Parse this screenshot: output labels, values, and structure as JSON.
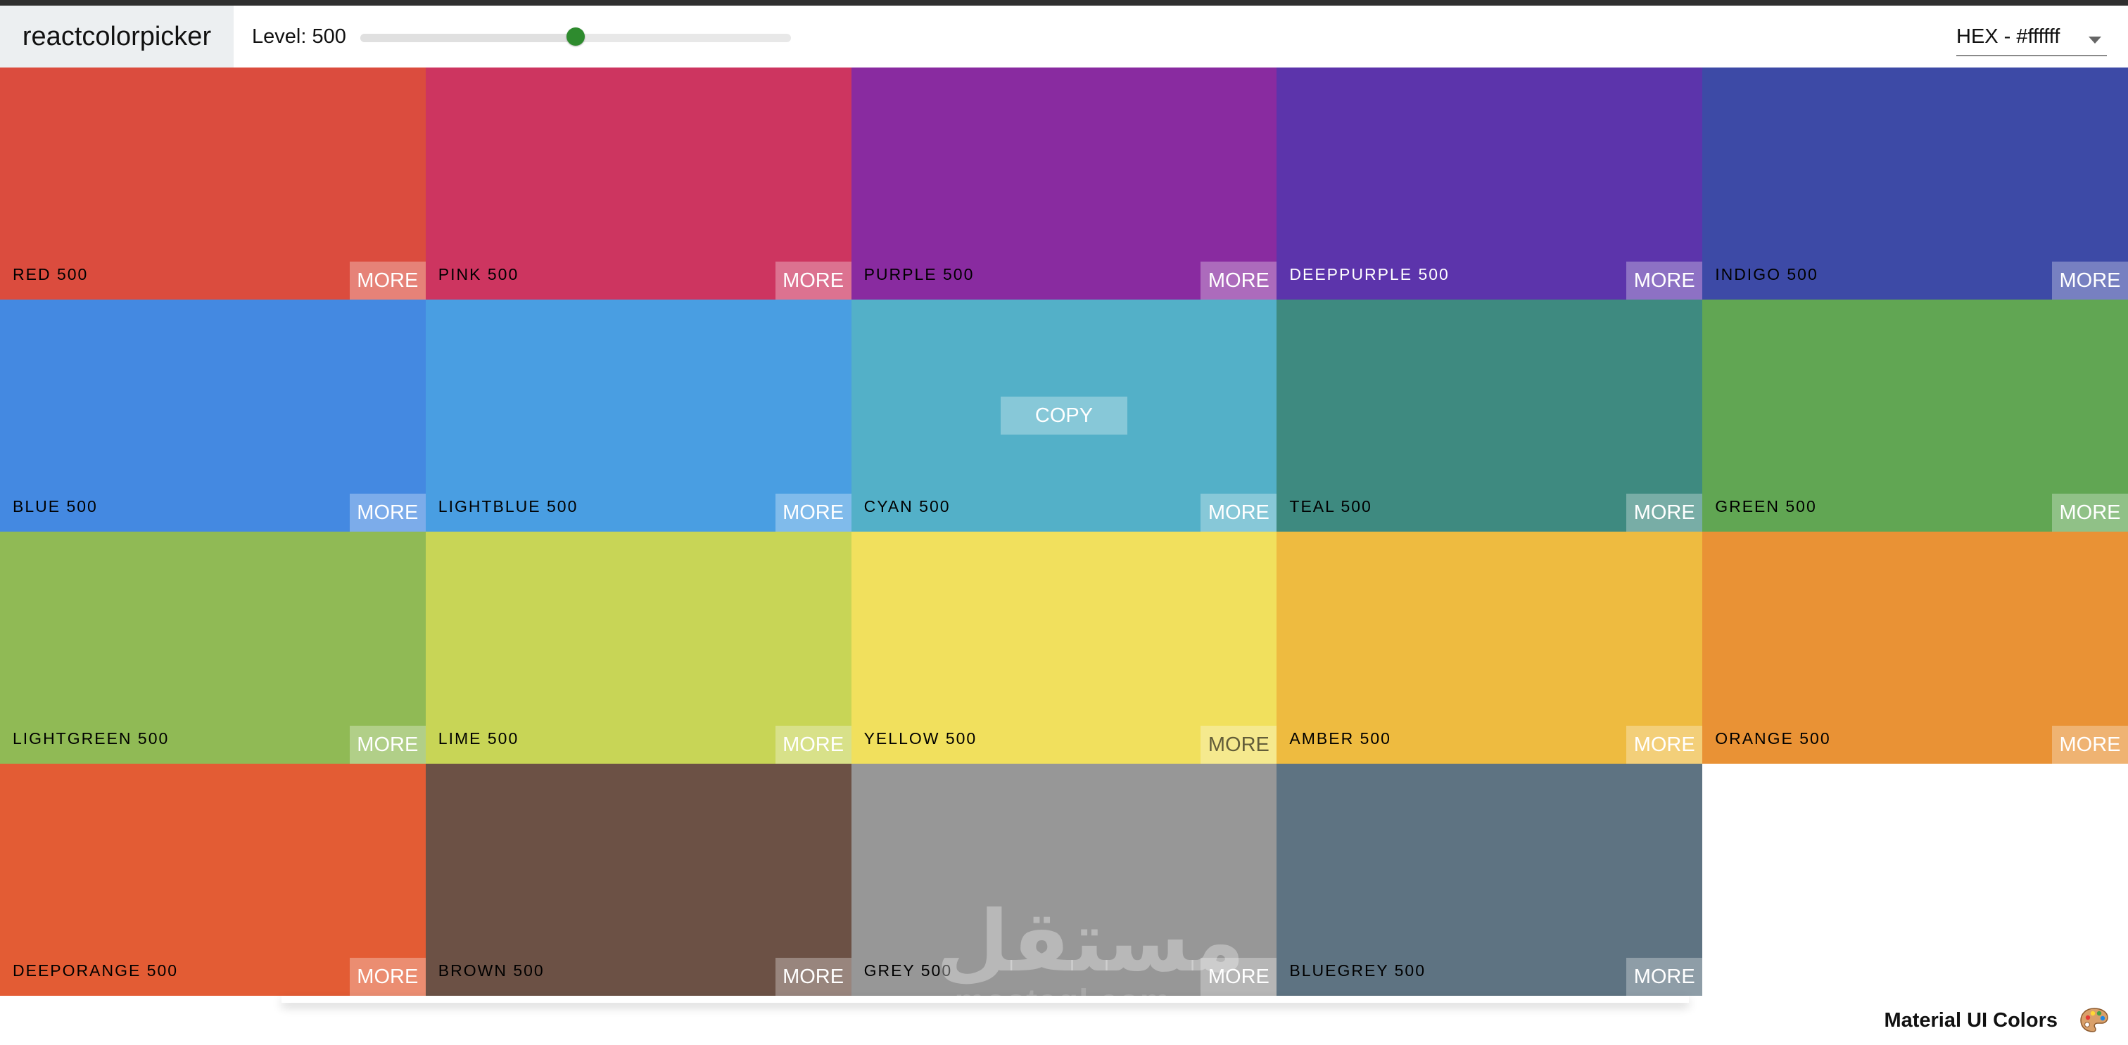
{
  "navbar": {
    "logo": "reactcolorpicker",
    "level_label": "Level: 500",
    "level_value": 500,
    "level_min": 100,
    "level_max": 900,
    "format_label": "HEX - #ffffff"
  },
  "palette": {
    "colors": [
      {
        "name": "red 500",
        "color": "#db4c3e",
        "text": "dark",
        "more": "MORE",
        "more_text": "light"
      },
      {
        "name": "pink 500",
        "color": "#cd3560",
        "text": "dark",
        "more": "MORE",
        "more_text": "light"
      },
      {
        "name": "purple 500",
        "color": "#892ba0",
        "text": "dark",
        "more": "MORE",
        "more_text": "light"
      },
      {
        "name": "deeppurple 500",
        "color": "#5c34ab",
        "text": "light",
        "more": "MORE",
        "more_text": "light"
      },
      {
        "name": "indigo 500",
        "color": "#3d4aa6",
        "text": "dark",
        "more": "MORE",
        "more_text": "light"
      },
      {
        "name": "blue 500",
        "color": "#4489e1",
        "text": "dark",
        "more": "MORE",
        "more_text": "light"
      },
      {
        "name": "lightblue 500",
        "color": "#499ee2",
        "text": "dark",
        "more": "MORE",
        "more_text": "light"
      },
      {
        "name": "cyan 500",
        "color": "#53b0c8",
        "text": "dark",
        "more": "MORE",
        "more_text": "light",
        "copy": "COPY"
      },
      {
        "name": "teal 500",
        "color": "#3e8a80",
        "text": "dark",
        "more": "MORE",
        "more_text": "light"
      },
      {
        "name": "green 500",
        "color": "#61a653",
        "text": "dark",
        "more": "MORE",
        "more_text": "light"
      },
      {
        "name": "lightgreen 500",
        "color": "#90ba55",
        "text": "dark",
        "more": "MORE",
        "more_text": "light"
      },
      {
        "name": "lime 500",
        "color": "#c8d556",
        "text": "dark",
        "more": "MORE",
        "more_text": "light"
      },
      {
        "name": "yellow 500",
        "color": "#f1e05d",
        "text": "dark",
        "more": "MORE",
        "more_text": "dark"
      },
      {
        "name": "amber 500",
        "color": "#eebb40",
        "text": "dark",
        "more": "MORE",
        "more_text": "light"
      },
      {
        "name": "orange 500",
        "color": "#e99235",
        "text": "dark",
        "more": "MORE",
        "more_text": "light"
      },
      {
        "name": "deeporange 500",
        "color": "#e35c34",
        "text": "dark",
        "more": "MORE",
        "more_text": "light"
      },
      {
        "name": "brown 500",
        "color": "#6c5145",
        "text": "dark",
        "more": "MORE",
        "more_text": "light"
      },
      {
        "name": "grey 500",
        "color": "#979797",
        "text": "dark",
        "more": "MORE",
        "more_text": "light"
      },
      {
        "name": "bluegrey 500",
        "color": "#5e7382",
        "text": "dark",
        "more": "MORE",
        "more_text": "light"
      }
    ]
  },
  "watermark": {
    "arabic": "مستقل",
    "latin": "mostaql.com"
  },
  "footer": {
    "label": "Material UI Colors",
    "emoji_icon": "artist-palette-icon"
  }
}
